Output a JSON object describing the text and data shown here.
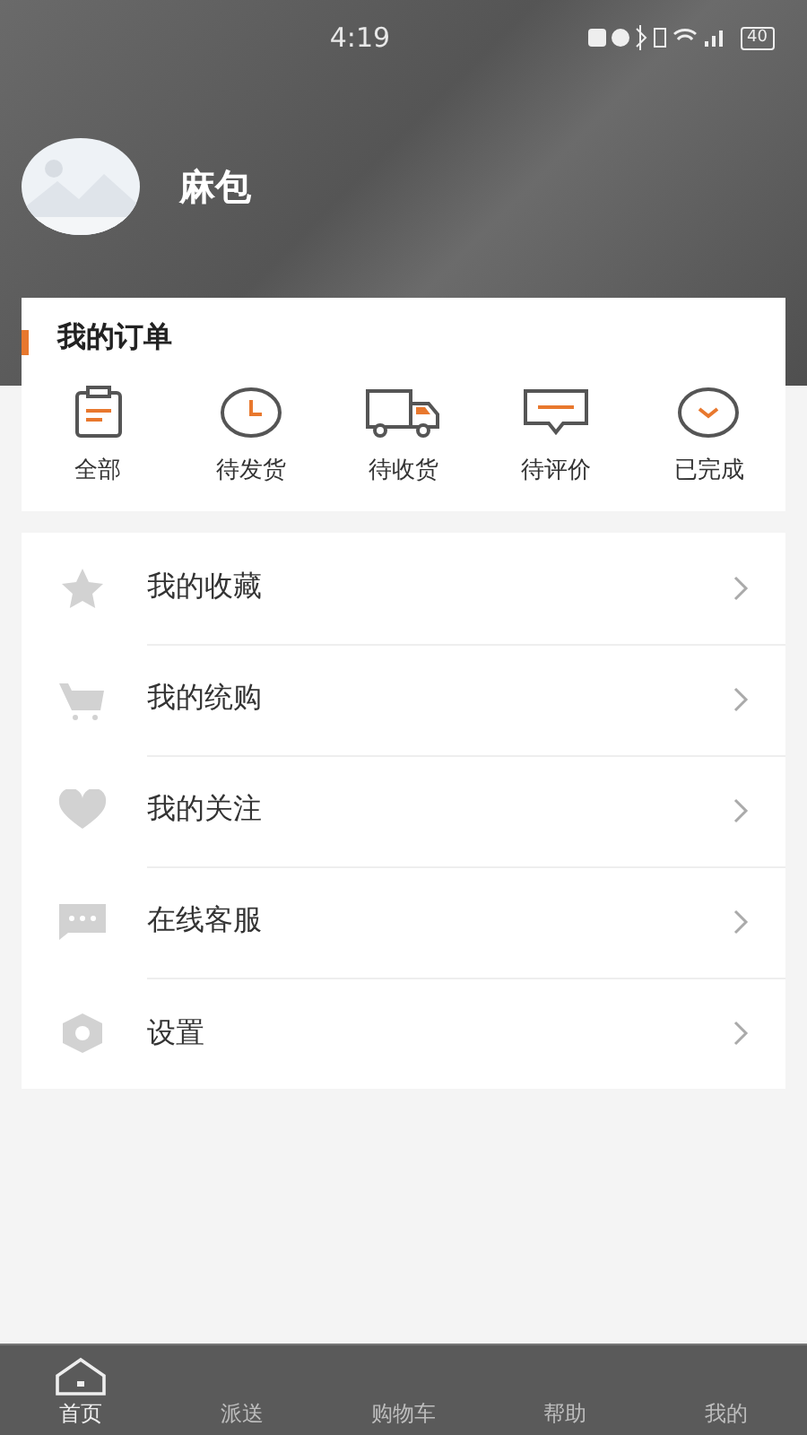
{
  "status_bar": {
    "time": "4:19",
    "battery": "40"
  },
  "profile": {
    "name": "麻包"
  },
  "orders": {
    "title": "我的订单",
    "items": [
      {
        "kind": "clipboard",
        "label": "全部"
      },
      {
        "kind": "clock",
        "label": "待发货"
      },
      {
        "kind": "truck",
        "label": "待收货"
      },
      {
        "kind": "comment",
        "label": "待评价"
      },
      {
        "kind": "check",
        "label": "已完成"
      }
    ]
  },
  "menu": [
    {
      "kind": "star",
      "label": "我的收藏"
    },
    {
      "kind": "cart",
      "label": "我的统购"
    },
    {
      "kind": "heart",
      "label": "我的关注"
    },
    {
      "kind": "chat",
      "label": "在线客服"
    },
    {
      "kind": "settings",
      "label": "设置"
    }
  ],
  "tab_bar": [
    {
      "label": "首页",
      "selected": true
    },
    {
      "label": "派送",
      "selected": false
    },
    {
      "label": "购物车",
      "selected": false
    },
    {
      "label": "帮助",
      "selected": false
    },
    {
      "label": "我的",
      "selected": false
    }
  ]
}
